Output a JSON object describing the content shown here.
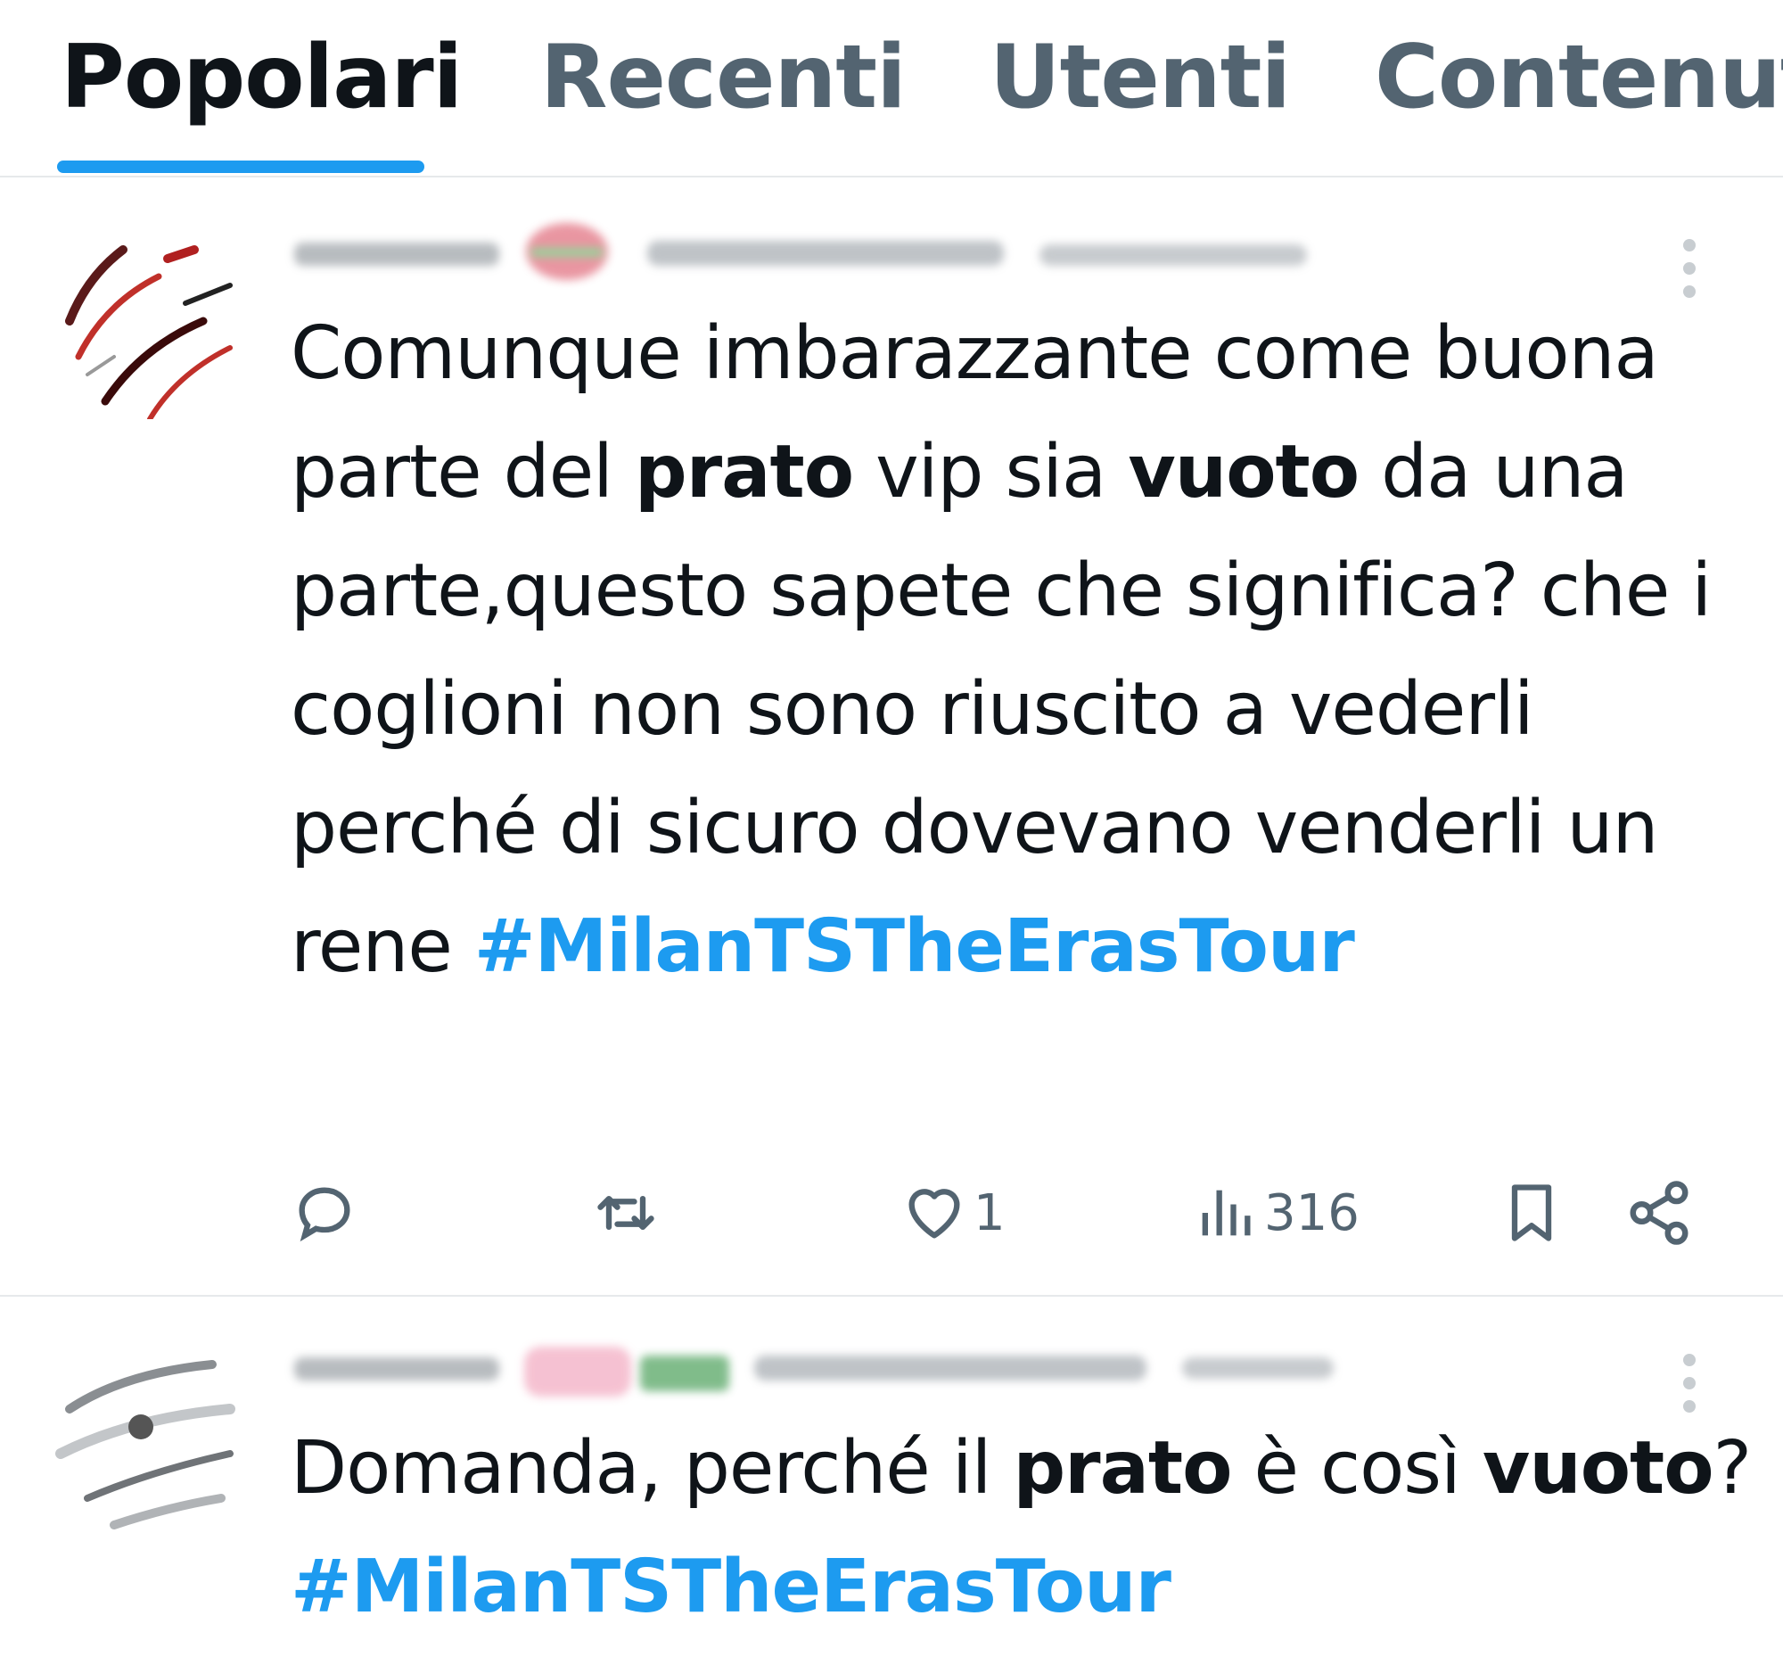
{
  "tabs": [
    {
      "label": "Popolari",
      "active": true
    },
    {
      "label": "Recenti",
      "active": false
    },
    {
      "label": "Utenti",
      "active": false
    },
    {
      "label": "Contenuti",
      "active": false
    }
  ],
  "colors": {
    "accent": "#1d9bf0",
    "text_primary": "#0f1419",
    "text_secondary": "#536471",
    "divider": "#e6e9eb"
  },
  "tweets": [
    {
      "text_parts": [
        {
          "t": "Comunque imbarazzante come buona parte del ",
          "style": "normal"
        },
        {
          "t": "prato",
          "style": "bold"
        },
        {
          "t": " vip sia ",
          "style": "normal"
        },
        {
          "t": "vuoto",
          "style": "bold"
        },
        {
          "t": " da una parte,questo sapete che significa? che i coglioni non sono riuscito a vederli perché di sicuro dovevano venderli un rene ",
          "style": "normal"
        },
        {
          "t": "#MilanTSTheErasTour",
          "style": "hashtag"
        }
      ],
      "actions": {
        "reply": {
          "icon": "reply-icon",
          "count": ""
        },
        "retweet": {
          "icon": "retweet-icon",
          "count": ""
        },
        "like": {
          "icon": "heart-icon",
          "count": "1"
        },
        "views": {
          "icon": "views-icon",
          "count": "316"
        },
        "bookmark": {
          "icon": "bookmark-icon"
        },
        "share": {
          "icon": "share-icon"
        }
      }
    },
    {
      "text_parts": [
        {
          "t": "Domanda, perché il ",
          "style": "normal"
        },
        {
          "t": "prato",
          "style": "bold"
        },
        {
          "t": " è così ",
          "style": "normal"
        },
        {
          "t": "vuoto",
          "style": "bold"
        },
        {
          "t": "? ",
          "style": "normal"
        },
        {
          "t": "#MilanTSTheErasTour",
          "style": "hashtag"
        }
      ]
    }
  ]
}
